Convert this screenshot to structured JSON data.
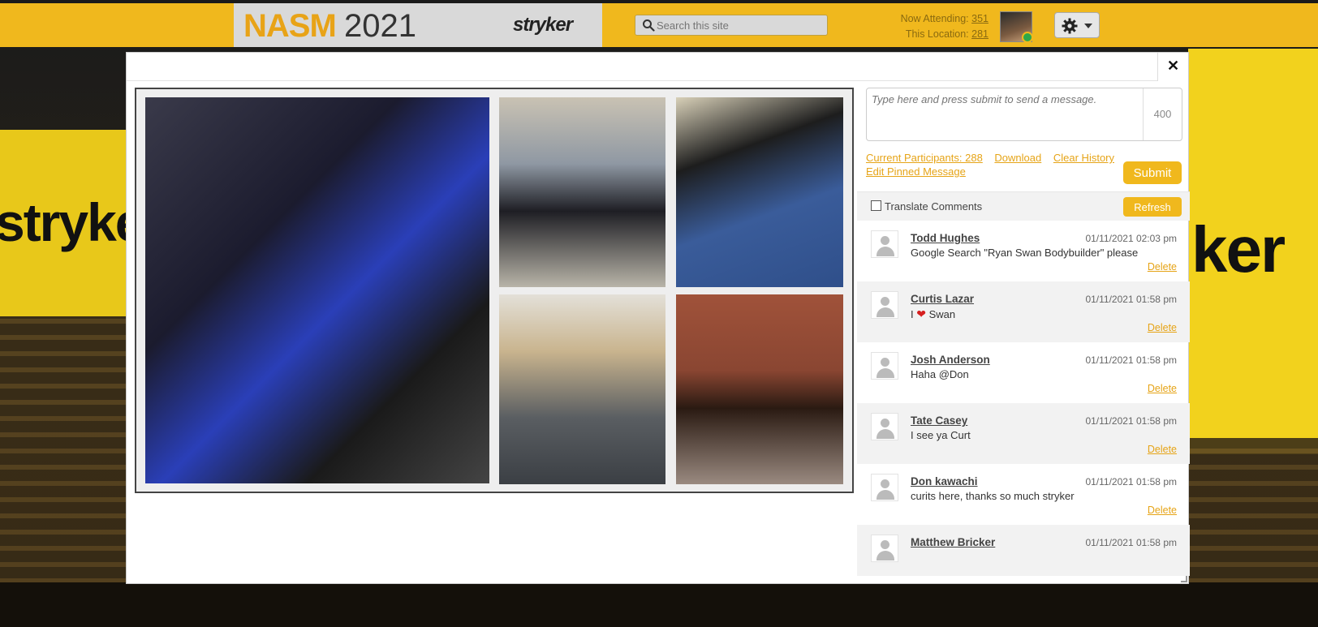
{
  "header": {
    "logo_nasm": "NASM",
    "logo_year": "2021",
    "sponsor": "stryker",
    "search_placeholder": "Search this site",
    "now_attending_label": "Now Attending:",
    "now_attending_count": "351",
    "this_location_label": "This Location:",
    "this_location_count": "281"
  },
  "background": {
    "brand_left": "stryke",
    "brand_right": "ker"
  },
  "modal": {
    "close_label": "✕"
  },
  "chat": {
    "message_placeholder": "Type here and press submit to send a message.",
    "char_counter": "400",
    "links": {
      "participants": "Current Participants: 288",
      "download": "Download",
      "clear_history": "Clear History",
      "edit_pinned": "Edit Pinned Message"
    },
    "submit_label": "Submit",
    "translate_label": "Translate Comments",
    "refresh_label": "Refresh",
    "delete_label": "Delete",
    "comments": [
      {
        "name": "Todd Hughes",
        "time": "01/11/2021 02:03 pm",
        "text": "Google Search \"Ryan Swan Bodybuilder\" please"
      },
      {
        "name": "Curtis Lazar",
        "time": "01/11/2021 01:58 pm",
        "text_before": "I",
        "heart": "❤",
        "text_after": "Swan"
      },
      {
        "name": "Josh Anderson",
        "time": "01/11/2021 01:58 pm",
        "text": "Haha @Don"
      },
      {
        "name": "Tate Casey",
        "time": "01/11/2021 01:58 pm",
        "text": "I see ya Curt"
      },
      {
        "name": "Don kawachi",
        "time": "01/11/2021 01:58 pm",
        "text": "curits here, thanks so much stryker"
      },
      {
        "name": "Matthew Bricker",
        "time": "01/11/2021 01:58 pm",
        "text": ""
      }
    ]
  },
  "colors": {
    "accent": "#f0b81d",
    "link": "#e6a417",
    "heart": "#d61f1f"
  }
}
